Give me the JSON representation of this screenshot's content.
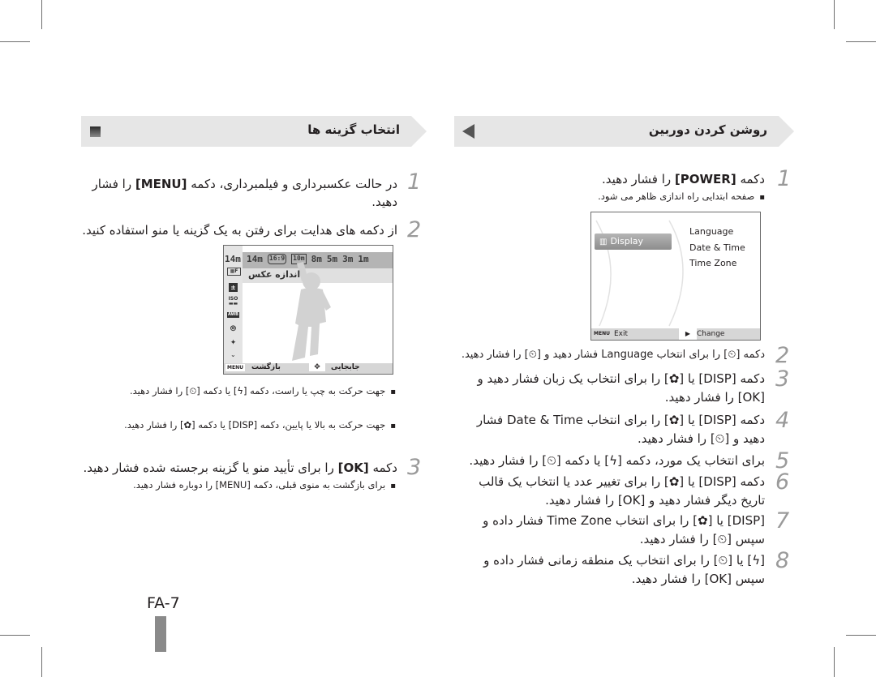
{
  "page_number": "FA-7",
  "left_section": {
    "title": "انتخاب گزینه ها",
    "icon": "square-icon",
    "steps": [
      {
        "num": "1",
        "text_before": "در حالت عکسبرداری و فیلمبرداری، دکمه ",
        "key": "[MENU]",
        "text_after": " را فشار دهید."
      },
      {
        "num": "2",
        "text": "از دکمه های هدایت برای رفتن به یک گزینه یا منو استفاده کنید."
      },
      {
        "num": "3",
        "text_before": "دکمه ",
        "key": "[OK]",
        "text_after": " را برای تأیید منو یا گزینه برجسته شده فشار دهید."
      }
    ],
    "bullets_step2": [
      "جهت حرکت به چپ یا راست، دکمه [ϟ] یا دکمه [⏲] را فشار دهید.",
      "جهت حرکت به بالا یا پایین، دکمه [DISP] یا دکمه [✿] را فشار دهید."
    ],
    "bullets_step3": [
      "برای بازگشت به منوی قبلی، دکمه [MENU] را دوباره فشار دهید."
    ],
    "camera_screen": {
      "selected_size": "14m",
      "sizes": [
        "14m",
        "16:9",
        "10m",
        "8m",
        "5m",
        "3m",
        "1m"
      ],
      "highlighted_label": "اندازه عکس",
      "left_icons": [
        "photo-size-icon",
        "exposure-icon",
        "iso-icon",
        "white-balance-icon",
        "face-detection-icon",
        "smart-filter-icon"
      ],
      "bottom_back_key": "MENU",
      "bottom_back_label": "بازگشت",
      "bottom_move_label": "جابجایی"
    }
  },
  "right_section": {
    "title": "روشن کردن دوربین",
    "icon": "arrow-left-icon",
    "step1": {
      "num": "1",
      "text_before": "دکمه ",
      "key": "[POWER]",
      "text_after": " را فشار دهید.",
      "bullet": "صفحه ابتدایی راه اندازی ظاهر می شود."
    },
    "camera_screen": {
      "category": "Display",
      "items": [
        "Language",
        "Date & Time",
        "Time Zone"
      ],
      "bottom_exit_key": "MENU",
      "bottom_exit_label": "Exit",
      "bottom_change_label": "Change"
    },
    "steps": [
      {
        "num": "2",
        "lines": [
          "دکمه [⏲] را برای انتخاب Language فشار دهید و [⏲] را فشار دهید."
        ]
      },
      {
        "num": "3",
        "lines": [
          "دکمه [DISP] یا [✿] را برای انتخاب یک زبان فشار دهید و",
          "[OK] را فشار دهید."
        ]
      },
      {
        "num": "4",
        "lines": [
          "دکمه [DISP] یا [✿] را برای انتخاب Date & Time فشار",
          "دهید و [⏲] را فشار دهید."
        ]
      },
      {
        "num": "5",
        "lines": [
          "برای انتخاب یک مورد، دکمه [ϟ] یا دکمه [⏲] را فشار دهید."
        ]
      },
      {
        "num": "6",
        "lines": [
          "دکمه [DISP] یا [✿] را برای تغییر عدد یا انتخاب یک قالب",
          "تاریخ دیگر فشار دهید و [OK] را فشار دهید."
        ]
      },
      {
        "num": "7",
        "lines": [
          "[DISP] یا [✿] را برای انتخاب Time Zone فشار داده و",
          "سپس [⏲] را فشار دهید."
        ]
      },
      {
        "num": "8",
        "lines": [
          "[ϟ] یا [⏲] را برای انتخاب یک منطقه زمانی فشار داده و",
          "سپس [OK] را فشار دهید."
        ]
      }
    ]
  }
}
